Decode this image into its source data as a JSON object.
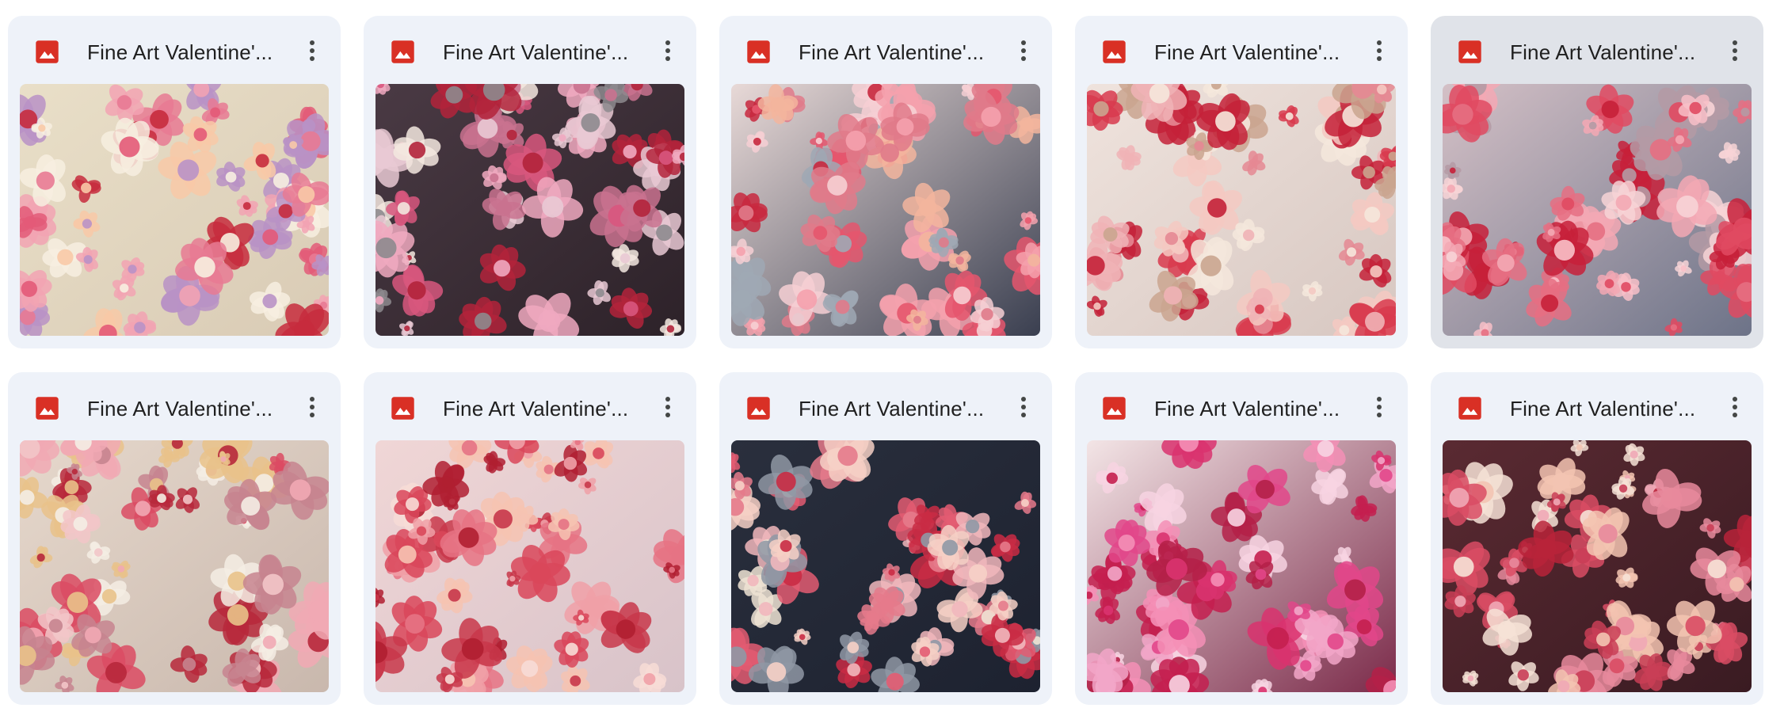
{
  "files": [
    {
      "name": "Fine Art Valentine'...",
      "icon": "image-file-icon",
      "selected": false,
      "palette": {
        "bg1": "#e9dfc8",
        "bg2": "#d9cbb5",
        "flowers": [
          "#e35a78",
          "#f2a3b3",
          "#c72b3d",
          "#f7efe0",
          "#b992c6",
          "#f8c9a7",
          "#e87a93"
        ]
      }
    },
    {
      "name": "Fine Art Valentine'...",
      "icon": "image-file-icon",
      "selected": false,
      "palette": {
        "bg1": "#4a3a44",
        "bg2": "#2d2229",
        "flowers": [
          "#d8577e",
          "#f0a9c0",
          "#b3233b",
          "#f3e8df",
          "#c9728f",
          "#8d8a8e",
          "#e9c9d4"
        ]
      }
    },
    {
      "name": "Fine Art Valentine'...",
      "icon": "image-file-icon",
      "selected": false,
      "palette": {
        "bg1": "#e8d9d7",
        "bg2": "#3a3f50",
        "flowers": [
          "#e5566d",
          "#f5a1ad",
          "#c8283e",
          "#f3b59d",
          "#e07a8a",
          "#9fa8b4",
          "#f6cfd3"
        ]
      }
    },
    {
      "name": "Fine Art Valentine'...",
      "icon": "image-file-icon",
      "selected": false,
      "palette": {
        "bg1": "#efe3dd",
        "bg2": "#d7c7c1",
        "flowers": [
          "#d83a4d",
          "#f4c9c2",
          "#c42138",
          "#f5e7dc",
          "#e58893",
          "#caa58f",
          "#f0b3b6"
        ]
      }
    },
    {
      "name": "Fine Art Valentine'...",
      "icon": "image-file-icon",
      "selected": true,
      "palette": {
        "bg1": "#d4c0c6",
        "bg2": "#6d7388",
        "flowers": [
          "#e04a62",
          "#f3a8b4",
          "#c72039",
          "#f7d3d6",
          "#e66f82",
          "#b49aa4",
          "#f8c0c8"
        ]
      }
    },
    {
      "name": "Fine Art Valentine'...",
      "icon": "image-file-icon",
      "selected": false,
      "palette": {
        "bg1": "#e6d8cc",
        "bg2": "#c9b8ad",
        "flowers": [
          "#db4b63",
          "#f1a9b4",
          "#b7283b",
          "#f4ede4",
          "#e9c28a",
          "#c7848f",
          "#f2c5c8"
        ]
      }
    },
    {
      "name": "Fine Art Valentine'...",
      "icon": "image-file-icon",
      "selected": false,
      "palette": {
        "bg1": "#f0d6d6",
        "bg2": "#d8c3c9",
        "flowers": [
          "#d9475a",
          "#f0a0a7",
          "#b01f31",
          "#f6c3b2",
          "#e67384",
          "#c8374a",
          "#f7dcd6"
        ]
      }
    },
    {
      "name": "Fine Art Valentine'...",
      "icon": "image-file-icon",
      "selected": false,
      "palette": {
        "bg1": "#2a2f3d",
        "bg2": "#1d2230",
        "flowers": [
          "#e35c72",
          "#f1b7bc",
          "#c92b44",
          "#eee3d4",
          "#8f98a5",
          "#e57a8b",
          "#f6d0c6"
        ]
      }
    },
    {
      "name": "Fine Art Valentine'...",
      "icon": "image-file-icon",
      "selected": false,
      "palette": {
        "bg1": "#f3e5e6",
        "bg2": "#7b2b4a",
        "flowers": [
          "#e2478a",
          "#f2a6c8",
          "#c41f4f",
          "#f7d4e2",
          "#d9336f",
          "#f48fb6",
          "#b42048"
        ]
      }
    },
    {
      "name": "Fine Art Valentine'...",
      "icon": "image-file-icon",
      "selected": false,
      "palette": {
        "bg1": "#5a2a32",
        "bg2": "#3a1b22",
        "flowers": [
          "#f0a8b6",
          "#d94c64",
          "#f6e2d6",
          "#b8233a",
          "#e88a9c",
          "#f3c4b2",
          "#c93e56"
        ]
      }
    }
  ]
}
